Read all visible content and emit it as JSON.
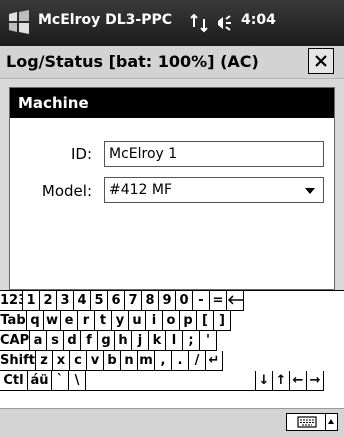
{
  "status_bar": {
    "app_name": "McElroy DL3-PPC",
    "time": "4:04",
    "icons": [
      "windows-start-logo",
      "connectivity-icon",
      "volume-icon"
    ]
  },
  "window": {
    "title": "Log/Status  [bat: 100%] (AC)",
    "close_label": "✕"
  },
  "machine_panel": {
    "header": "Machine",
    "id_label": "ID:",
    "id_value": "McElroy 1",
    "model_label": "Model:",
    "model_value": "#412 MF"
  },
  "keyboard": {
    "rows": [
      [
        "123",
        "1",
        "2",
        "3",
        "4",
        "5",
        "6",
        "7",
        "8",
        "9",
        "0",
        "-",
        "=",
        "🡐"
      ],
      [
        "Tab",
        "q",
        "w",
        "e",
        "r",
        "t",
        "y",
        "u",
        "i",
        "o",
        "p",
        "[",
        "]"
      ],
      [
        "CAP",
        "a",
        "s",
        "d",
        "f",
        "g",
        "h",
        "j",
        "k",
        "l",
        ";",
        "'"
      ],
      [
        "Shift",
        "z",
        "x",
        "c",
        "v",
        "b",
        "n",
        "m",
        ",",
        ".",
        "/",
        "↵"
      ],
      [
        "Ctl",
        "áü",
        "`",
        "\\",
        "",
        "↓",
        "↑",
        "←",
        "→"
      ]
    ]
  },
  "colors": {
    "status_bar": "#2a2a2a",
    "title_bar": "#d3d3d3",
    "panel_header": "#000000",
    "content_bg": "#d9d9d9"
  }
}
